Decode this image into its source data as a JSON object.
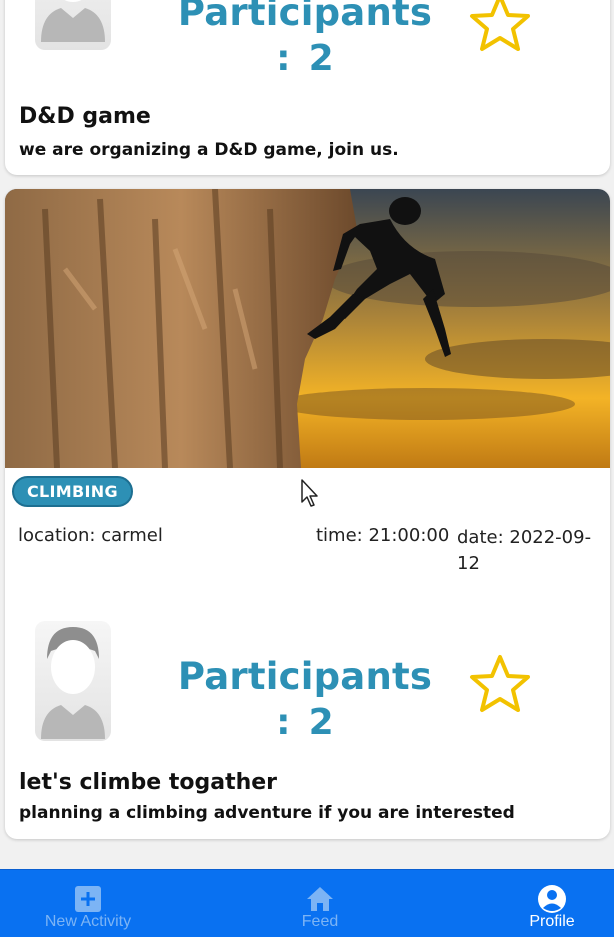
{
  "cards": [
    {
      "participants_label": "Participants",
      "participants_colon": ":",
      "participants_count": "2",
      "title": "D&D game",
      "description": "we are organizing a D&D game, join us."
    },
    {
      "image": "rock-climber-sunset",
      "tag": "CLIMBING",
      "location": "location: carmel",
      "time": "time: 21:00:00",
      "date": "date: 2022-09-12",
      "participants_label": "Participants",
      "participants_colon": ":",
      "participants_count": "2",
      "title": "let's climbe togather",
      "description": "planning a climbing adventure if you are interested"
    }
  ],
  "nav": {
    "items": [
      {
        "label": "New Activity",
        "icon": "plus-square-icon",
        "active": false
      },
      {
        "label": "Feed",
        "icon": "home-icon",
        "active": false
      },
      {
        "label": "Profile",
        "icon": "account-circle-icon",
        "active": true
      }
    ]
  },
  "colors": {
    "accent": "#2d90b5",
    "star": "#f2c200",
    "nav_bg": "#0971f1",
    "nav_inactive": "#7cb4f5"
  }
}
